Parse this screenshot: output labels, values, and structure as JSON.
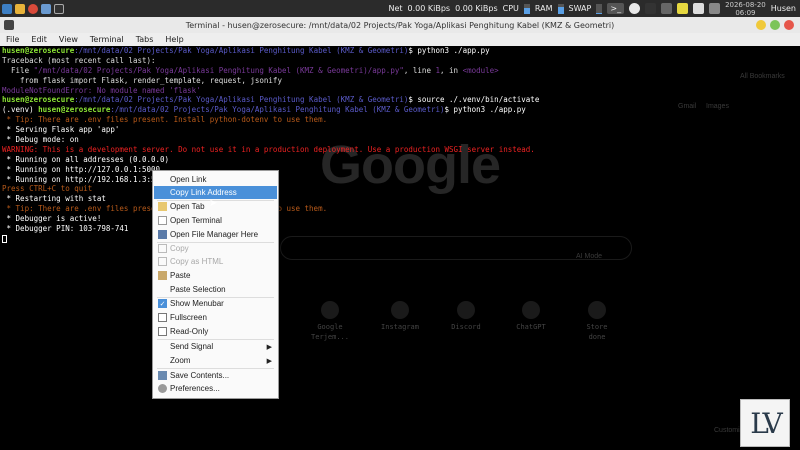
{
  "panel": {
    "net_label": "Net",
    "net_down": "0.00 KiBps",
    "net_up": "0.00 KiBps",
    "cpu_label": "CPU",
    "ram_label": "RAM",
    "swap_label": "SWAP",
    "cpu_level": 0.6,
    "ram_level": 0.7,
    "swap_level": 0.1,
    "date": "2026-08-20",
    "time": "06:09",
    "user": "Husen"
  },
  "window": {
    "title": "Terminal - husen@zerosecure: /mnt/data/02 Projects/Pak Yoga/Aplikasi Penghitung Kabel (KMZ & Geometri)"
  },
  "menubar": [
    "File",
    "Edit",
    "View",
    "Terminal",
    "Tabs",
    "Help"
  ],
  "terminal": {
    "prompt_user": "husen@zerosecure",
    "path": ":/mnt/data/02 Projects/Pak Yoga/Aplikasi Penghitung Kabel (KMZ & Geometri)",
    "cmd1": "$ python3 ./app.py",
    "tb_header": "Traceback (most recent call last):",
    "tb_file": "  File ",
    "tb_file_path": "\"/mnt/data/02 Projects/Pak Yoga/Aplikasi Penghitung Kabel (KMZ & Geometri)/app.py\"",
    "tb_line": ", line ",
    "tb_lineno": "1",
    "tb_in": ", in ",
    "tb_module": "<module>",
    "tb_code": "    from flask import Flask, render_template, request, jsonify",
    "err_name": "ModuleNotFoundError",
    "err_msg": ": No module named 'flask'",
    "cmd2": "$ source ./.venv/bin/activate",
    "venv": "(.venv) ",
    "cmd3": "$ python3 ./app.py",
    "tip1": " * Tip: There are .env files present. Install python-dotenv to use them.",
    "serving": " * Serving Flask app 'app'",
    "debug": " * Debug mode: on",
    "warning": "WARNING: This is a development server. Do not use it in a production deployment. Use a production WSGI server instead.",
    "run_all": " * Running on all addresses (0.0.0.0)",
    "run_local": " * Running on http://127.0.0.1:5000",
    "run_lan": " * Running on http://192.168.1.3:5000",
    "quit": "Press CTRL+C to quit",
    "restart": " * Restarting with stat",
    "tip2": " * Tip: There are .env files present. Install python-dotenv to use them.",
    "debugger": " * Debugger is active!",
    "pin": " * Debugger PIN: 103-798-741"
  },
  "background_browser": {
    "logo_text": "Google",
    "bookmarks": "All Bookmarks",
    "gmail": "Gmail",
    "images": "Images",
    "ai_mode": "AI Mode",
    "shortcuts": [
      "Google Terjem...",
      "Instagram",
      "Discord",
      "ChatGPT",
      "Store done"
    ],
    "customize": "Customize"
  },
  "context_menu": {
    "items": [
      {
        "label": "Open Link",
        "icon": "",
        "state": "normal"
      },
      {
        "label": "Copy Link Address",
        "icon": "",
        "state": "highlighted"
      },
      {
        "label": "Open Tab",
        "icon": "folder-icon",
        "state": "normal"
      },
      {
        "label": "Open Terminal",
        "icon": "document-icon",
        "state": "normal"
      },
      {
        "label": "Open File Manager Here",
        "icon": "file-manager-icon",
        "state": "normal"
      },
      {
        "label": "Copy",
        "icon": "copy-icon",
        "state": "disabled"
      },
      {
        "label": "Copy as HTML",
        "icon": "copy-icon",
        "state": "disabled"
      },
      {
        "label": "Paste",
        "icon": "paste-icon",
        "state": "normal"
      },
      {
        "label": "Paste Selection",
        "icon": "",
        "state": "normal"
      },
      {
        "label": "Show Menubar",
        "icon": "checkbox",
        "state": "checked"
      },
      {
        "label": "Fullscreen",
        "icon": "checkbox",
        "state": "unchecked"
      },
      {
        "label": "Read-Only",
        "icon": "checkbox",
        "state": "unchecked"
      },
      {
        "label": "Send Signal",
        "icon": "",
        "state": "submenu"
      },
      {
        "label": "Zoom",
        "icon": "",
        "state": "submenu"
      },
      {
        "label": "Save Contents...",
        "icon": "save-icon",
        "state": "normal"
      },
      {
        "label": "Preferences...",
        "icon": "preferences-icon",
        "state": "normal"
      }
    ]
  },
  "watermark": {
    "text": "LV"
  },
  "colors": {
    "prompt_green": "#8ae234",
    "path_blue": "#5a5ac8",
    "error_red": "#e22",
    "highlight_blue": "#4a90d9"
  }
}
